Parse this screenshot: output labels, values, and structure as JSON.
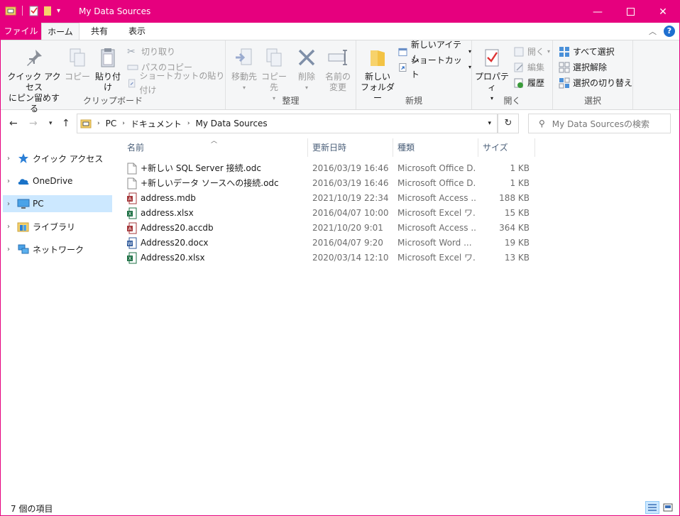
{
  "window": {
    "title": "My Data Sources"
  },
  "tabs": {
    "file": "ファイル",
    "home": "ホーム",
    "share": "共有",
    "view": "表示"
  },
  "ribbon": {
    "clipboard": {
      "label": "クリップボード",
      "pin_line1": "クイック アクセス",
      "pin_line2": "にピン留めする",
      "copy": "コピー",
      "paste": "貼り付け",
      "cut": "切り取り",
      "copy_path": "パスのコピー",
      "paste_shortcut": "ショートカットの貼り付け"
    },
    "organize": {
      "label": "整理",
      "move_to": "移動先",
      "copy_to": "コピー先",
      "delete": "削除",
      "rename_line1": "名前の",
      "rename_line2": "変更"
    },
    "new": {
      "label": "新規",
      "new_folder_line1": "新しい",
      "new_folder_line2": "フォルダー",
      "new_item": "新しいアイテム",
      "shortcut": "ショートカット"
    },
    "open": {
      "label": "開く",
      "properties": "プロパティ",
      "open": "開く",
      "edit": "編集",
      "history": "履歴"
    },
    "select": {
      "label": "選択",
      "select_all": "すべて選択",
      "select_none": "選択解除",
      "invert": "選択の切り替え"
    }
  },
  "address": {
    "crumbs": [
      "PC",
      "ドキュメント",
      "My Data Sources"
    ],
    "search_placeholder": "My Data Sourcesの検索"
  },
  "nav": {
    "items": [
      {
        "label": "クイック アクセス",
        "icon": "star-icon"
      },
      {
        "label": "OneDrive",
        "icon": "cloud-icon"
      },
      {
        "label": "PC",
        "icon": "computer-icon"
      },
      {
        "label": "ライブラリ",
        "icon": "library-icon"
      },
      {
        "label": "ネットワーク",
        "icon": "network-icon"
      }
    ]
  },
  "columns": {
    "name": "名前",
    "date": "更新日時",
    "type": "種類",
    "size": "サイズ"
  },
  "files": [
    {
      "name": "+新しい SQL Server 接続.odc",
      "date": "2016/03/19 16:46",
      "type": "Microsoft Office D...",
      "size": "1 KB",
      "icon": "odc"
    },
    {
      "name": "+新しいデータ ソースへの接続.odc",
      "date": "2016/03/19 16:46",
      "type": "Microsoft Office D...",
      "size": "1 KB",
      "icon": "odc"
    },
    {
      "name": "address.mdb",
      "date": "2021/10/19 22:34",
      "type": "Microsoft Access ...",
      "size": "188 KB",
      "icon": "mdb"
    },
    {
      "name": "address.xlsx",
      "date": "2016/04/07 10:00",
      "type": "Microsoft Excel ワ...",
      "size": "15 KB",
      "icon": "xlsx"
    },
    {
      "name": "Address20.accdb",
      "date": "2021/10/20 9:01",
      "type": "Microsoft Access ...",
      "size": "364 KB",
      "icon": "accdb"
    },
    {
      "name": "Address20.docx",
      "date": "2016/04/07 9:20",
      "type": "Microsoft Word ...",
      "size": "19 KB",
      "icon": "docx"
    },
    {
      "name": "Address20.xlsx",
      "date": "2020/03/14 12:10",
      "type": "Microsoft Excel ワ...",
      "size": "13 KB",
      "icon": "xlsx"
    }
  ],
  "status": {
    "count": "7 個の項目"
  },
  "colors": {
    "accent": "#e6007e",
    "selection": "#cce8ff",
    "excel": "#1d7044",
    "access": "#a4373a",
    "word": "#2b579a"
  }
}
